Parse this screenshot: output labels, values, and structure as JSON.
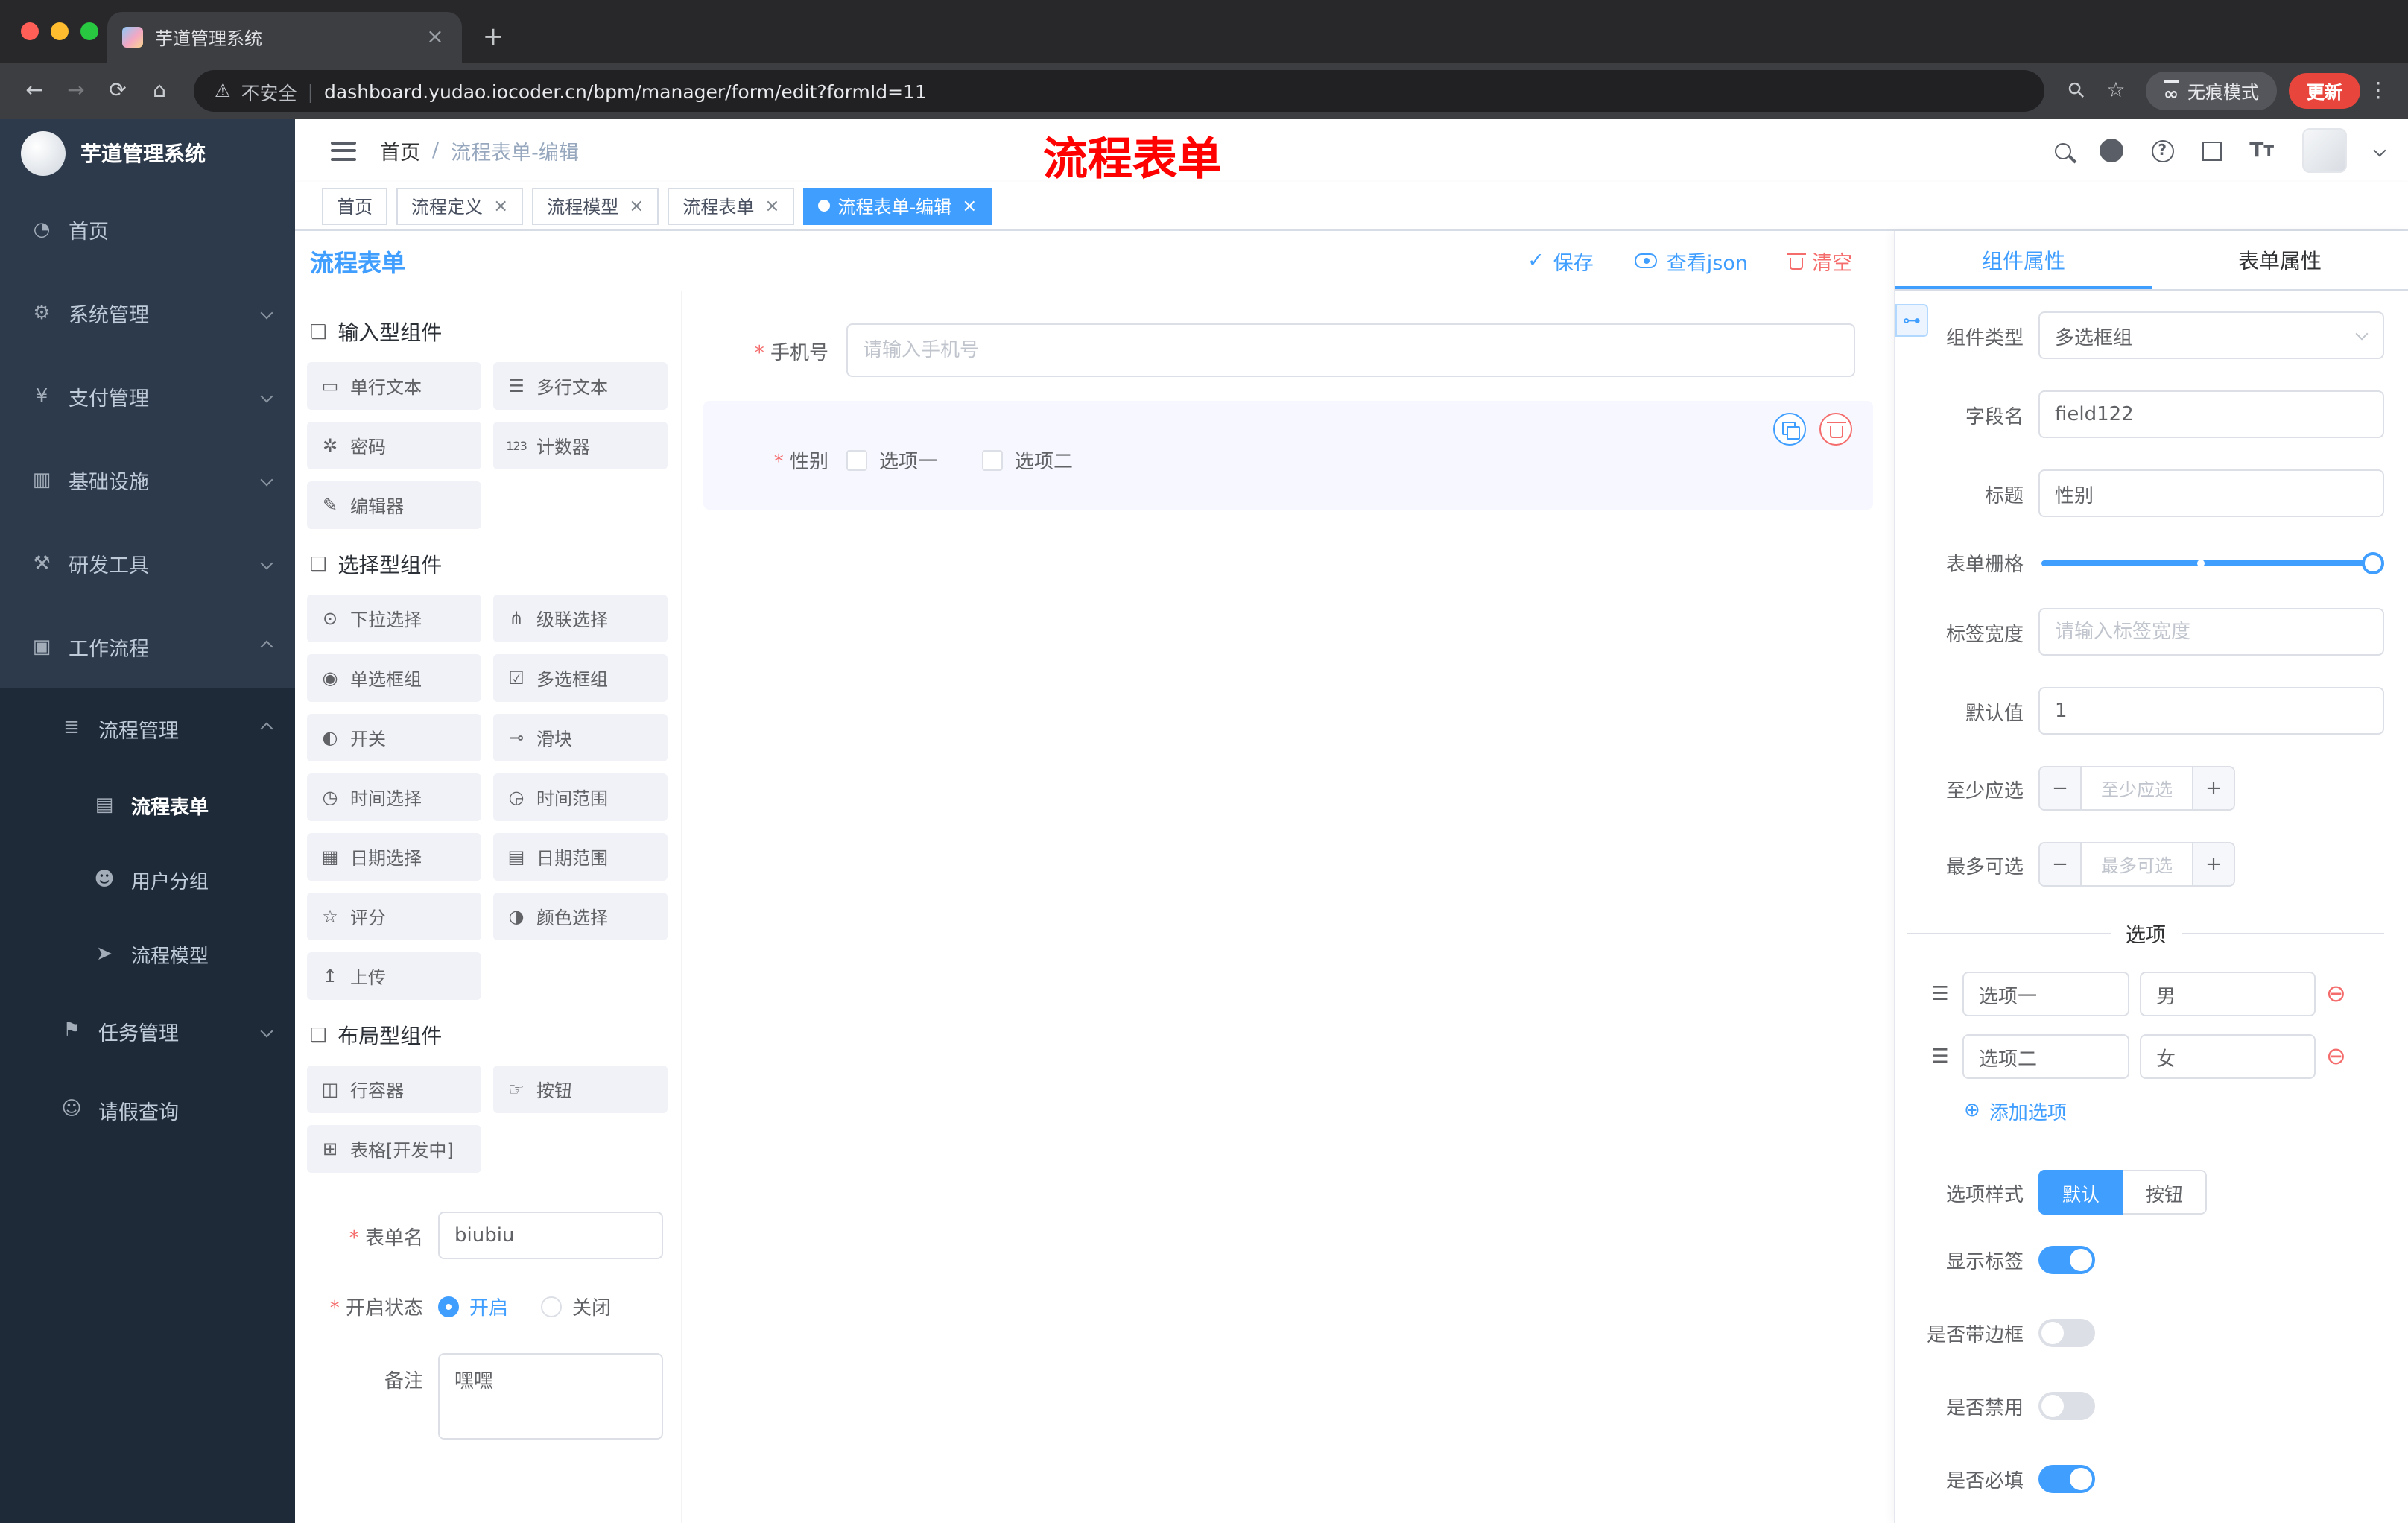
{
  "theme": {
    "primary": "#409eff",
    "danger": "#f56c6c",
    "annotation_red": "#fe0101",
    "sidebar_bg": "#2d3a4b",
    "active_tab_bg": "#409eff",
    "update_button_bg": "#e8453c"
  },
  "browser": {
    "tab_title": "芋道管理系统",
    "close_icon": "×",
    "new_tab_icon": "+",
    "back_icon": "←",
    "forward_icon": "→",
    "reload_icon": "⟳",
    "home_icon": "⌂",
    "warning_icon": "⚠",
    "security_label": "不安全",
    "separator": "|",
    "url": "dashboard.yudao.iocoder.cn/bpm/manager/form/edit?formId=11",
    "key_icon": "⚲",
    "star_icon": "☆",
    "incognito_icon": "∞",
    "incognito_label": "无痕模式",
    "update_label": "更新",
    "menu_icon": "⋮"
  },
  "sidebar": {
    "app_title": "芋道管理系统",
    "items": [
      {
        "label": "首页",
        "icon": "◔"
      },
      {
        "label": "系统管理",
        "icon": "⚙"
      },
      {
        "label": "支付管理",
        "icon": "¥"
      },
      {
        "label": "基础设施",
        "icon": "▥"
      },
      {
        "label": "研发工具",
        "icon": "⚒"
      },
      {
        "label": "工作流程",
        "icon": "▣"
      },
      {
        "label": "流程管理",
        "icon": "≣"
      },
      {
        "label": "流程表单",
        "icon": "▤"
      },
      {
        "label": "用户分组",
        "icon": "☻"
      },
      {
        "label": "流程模型",
        "icon": "➤"
      },
      {
        "label": "任务管理",
        "icon": "⚑"
      },
      {
        "label": "请假查询",
        "icon": "☺"
      }
    ]
  },
  "header": {
    "breadcrumb_root": "首页",
    "breadcrumb_separator": "/",
    "breadcrumb_current": "流程表单-编辑",
    "help_icon": "?",
    "fontsize_icon_big": "T",
    "fontsize_icon_small": "T"
  },
  "annotation": "流程表单",
  "tagsview": {
    "close_icon": "×",
    "tabs": [
      {
        "label": "首页"
      },
      {
        "label": "流程定义"
      },
      {
        "label": "流程模型"
      },
      {
        "label": "流程表单"
      },
      {
        "label": "流程表单-编辑"
      }
    ]
  },
  "designer": {
    "title": "流程表单",
    "actions": {
      "save_icon": "✓",
      "save": "保存",
      "view_json": "查看json",
      "clear": "清空"
    },
    "palette": {
      "groups": [
        {
          "title": "输入型组件",
          "icon": "❏",
          "items": [
            {
              "label": "单行文本",
              "icon": "▭"
            },
            {
              "label": "多行文本",
              "icon": "☰"
            },
            {
              "label": "密码",
              "icon": "✲"
            },
            {
              "label": "计数器",
              "icon": "123"
            },
            {
              "label": "编辑器",
              "icon": "✎"
            }
          ]
        },
        {
          "title": "选择型组件",
          "icon": "❏",
          "items": [
            {
              "label": "下拉选择",
              "icon": "⊙"
            },
            {
              "label": "级联选择",
              "icon": "⋔"
            },
            {
              "label": "单选框组",
              "icon": "◉"
            },
            {
              "label": "多选框组",
              "icon": "☑"
            },
            {
              "label": "开关",
              "icon": "◐"
            },
            {
              "label": "滑块",
              "icon": "⊸"
            },
            {
              "label": "时间选择",
              "icon": "◷"
            },
            {
              "label": "时间范围",
              "icon": "◶"
            },
            {
              "label": "日期选择",
              "icon": "▦"
            },
            {
              "label": "日期范围",
              "icon": "▤"
            },
            {
              "label": "评分",
              "icon": "☆"
            },
            {
              "label": "颜色选择",
              "icon": "◑"
            },
            {
              "label": "上传",
              "icon": "↥"
            }
          ]
        },
        {
          "title": "布局型组件",
          "icon": "❏",
          "items": [
            {
              "label": "行容器",
              "icon": "◫"
            },
            {
              "label": "按钮",
              "icon": "☞"
            },
            {
              "label": "表格[开发中]",
              "icon": "⊞"
            }
          ]
        }
      ]
    },
    "meta": {
      "name_label": "表单名",
      "name_value": "biubiu",
      "status_label": "开启状态",
      "status_on": "开启",
      "status_off": "关闭",
      "remark_label": "备注",
      "remark_value": "嘿嘿"
    },
    "canvas": {
      "phone_label": "手机号",
      "phone_placeholder": "请输入手机号",
      "gender_label": "性别",
      "gender_option_1": "选项一",
      "gender_option_2": "选项二"
    },
    "props": {
      "tab_component": "组件属性",
      "tab_form": "表单属性",
      "link_icon": "⊶",
      "type_label": "组件类型",
      "type_value": "多选框组",
      "field_label": "字段名",
      "field_value": "field122",
      "title_label": "标题",
      "title_value": "性别",
      "grid_label": "表单栅格",
      "labelwidth_label": "标签宽度",
      "labelwidth_placeholder": "请输入标签宽度",
      "default_label": "默认值",
      "default_value": "1",
      "min_label": "至少应选",
      "min_placeholder": "至少应选",
      "max_label": "最多可选",
      "max_placeholder": "最多可选",
      "minus_icon": "−",
      "plus_icon": "+",
      "options_title": "选项",
      "drag_icon": "☰",
      "remove_icon": "⊖",
      "options": [
        {
          "label": "选项一",
          "value": "男"
        },
        {
          "label": "选项二",
          "value": "女"
        }
      ],
      "add_icon": "⊕",
      "add_option": "添加选项",
      "style_label": "选项样式",
      "style_default": "默认",
      "style_button": "按钮",
      "toggles": [
        {
          "label": "显示标签",
          "on": true
        },
        {
          "label": "是否带边框",
          "on": false
        },
        {
          "label": "是否禁用",
          "on": false
        },
        {
          "label": "是否必填",
          "on": true
        }
      ]
    }
  }
}
